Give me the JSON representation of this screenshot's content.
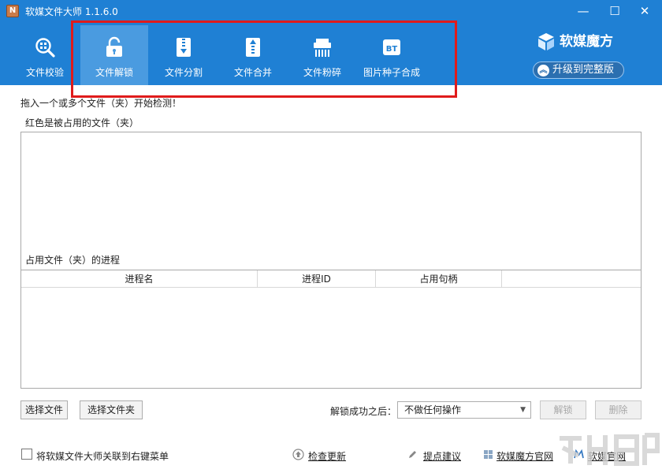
{
  "window": {
    "title": "软媒文件大师 1.1.6.0",
    "controls": {
      "minimize": "—",
      "maximize": "☐",
      "close": "✕"
    }
  },
  "toolbar": {
    "items": [
      {
        "label": "文件校验",
        "icon": "magnify-icon"
      },
      {
        "label": "文件解锁",
        "icon": "unlock-icon",
        "active": true
      },
      {
        "label": "文件分割",
        "icon": "zip-split-icon"
      },
      {
        "label": "文件合并",
        "icon": "zip-merge-icon"
      },
      {
        "label": "文件粉碎",
        "icon": "shredder-icon"
      },
      {
        "label": "图片种子合成",
        "icon": "bt-icon",
        "badge": "BT"
      }
    ]
  },
  "brand": {
    "name": "软媒魔方",
    "upgrade_label": "升级到完整版"
  },
  "main": {
    "hint": "拖入一个或多个文件（夹）开始检测！",
    "occupied_label": "红色是被占用的文件（夹）",
    "process_label": "占用文件（夹）的进程",
    "columns": [
      "进程名",
      "进程ID",
      "占用句柄"
    ]
  },
  "actions": {
    "select_file": "选择文件",
    "select_folder": "选择文件夹",
    "after_unlock_label": "解锁成功之后：",
    "after_unlock_value": "不做任何操作",
    "unlock": "解锁",
    "delete": "删除"
  },
  "footer": {
    "context_menu_label": "将软媒文件大师关联到右键菜单",
    "check_update": "检查更新",
    "feedback": "提点建议",
    "mofang_site": "软媒魔方官网",
    "ruanmei_site": "软媒官网"
  },
  "colors": {
    "header": "#1f80d4",
    "active_tab": "#4a9be0",
    "highlight": "#e01b1b"
  }
}
